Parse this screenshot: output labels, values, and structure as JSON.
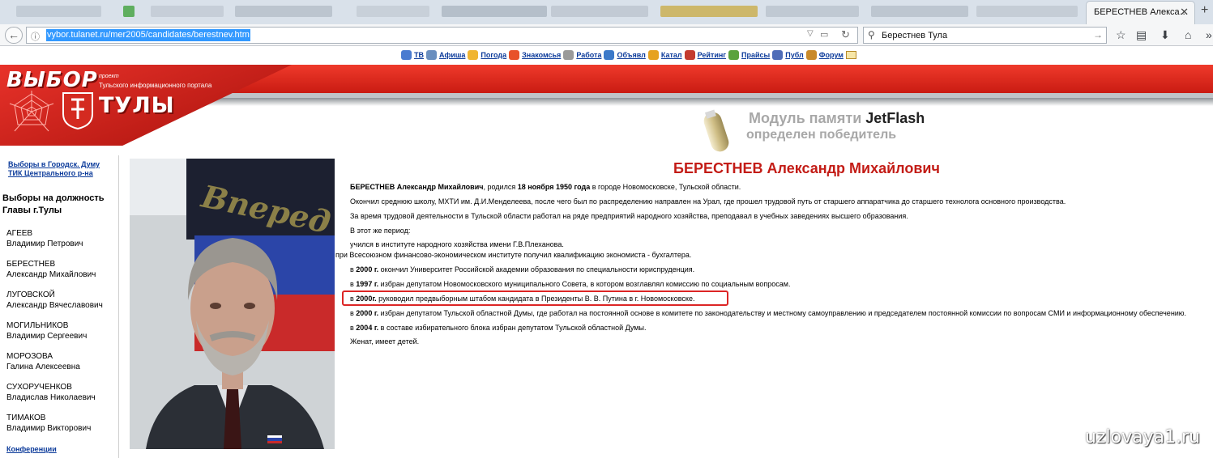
{
  "browser": {
    "tab_title": "БЕРЕСТНЕВ Алекса…",
    "url": "vybor.tulanet.ru/mer2005/candidates/berestnev.htm",
    "search_query": "Берестнев Тула"
  },
  "menu": {
    "items": [
      {
        "label": "ТВ",
        "color": "#4a7bd0"
      },
      {
        "label": "Афиша",
        "color": "#6a8fbf"
      },
      {
        "label": "Погода",
        "color": "#f0b531"
      },
      {
        "label": "Знакомсья",
        "color": "#e8522a"
      },
      {
        "label": "Работа",
        "color": "#9a9a9a"
      },
      {
        "label": "Объявл",
        "color": "#3b79c9"
      },
      {
        "label": "Катал",
        "color": "#e6a21f"
      },
      {
        "label": "Рейтинг",
        "color": "#c43b2e"
      },
      {
        "label": "Прайсы",
        "color": "#5aa23c"
      },
      {
        "label": "Публ",
        "color": "#4f6db8"
      },
      {
        "label": "Форум",
        "color": "#c98a2a"
      }
    ]
  },
  "header": {
    "site_name_1": "ВЫБОР",
    "site_name_2": "ТУЛЫ",
    "project_label": "проект",
    "project_desc": "Тульского информационного портала"
  },
  "ad": {
    "line1_prefix": "Модуль памяти ",
    "line1_brand": "JetFlash",
    "line2": "определен победитель"
  },
  "sidebar": {
    "link1": "Выборы в Городск. Думу",
    "link2": "ТИК Центрального р-на",
    "heading_1": "Выборы на должность",
    "heading_2": "Главы г.Тулы",
    "candidates": [
      {
        "surname": "АГЕЕВ",
        "name": "Владимир Петрович"
      },
      {
        "surname": "БЕРЕСТНЕВ",
        "name": "Александр Михайлович"
      },
      {
        "surname": "ЛУГОВСКОЙ",
        "name": "Александр Вячеславович"
      },
      {
        "surname": "МОГИЛЬНИКОВ",
        "name": "Владимир Сергеевич"
      },
      {
        "surname": "МОРОЗОВА",
        "name": "Галина Алексеевна"
      },
      {
        "surname": "СУХОРУЧЕНКОВ",
        "name": "Владислав Николаевич"
      },
      {
        "surname": "ТИМАКОВ",
        "name": "Владимир Викторович"
      }
    ],
    "conference_link": "Конференции"
  },
  "photo": {
    "flag_text": "Вперед"
  },
  "bio": {
    "title": "БЕРЕСТНЕВ Александр Михайлович",
    "p1_name": "БЕРЕСТНЕВ Александр Михайлович",
    "p1_mid": ", родился ",
    "p1_date": "18 ноября 1950 года",
    "p1_end": " в городе Новомосковске, Тульской области.",
    "p2": "Окончил среднюю школу, МХТИ им. Д.И.Менделеева, после чего был по распределению направлен на Урал, где прошел трудовой путь от старшего аппаратчика до старшего технолога основного производства.",
    "p3": "За время трудовой деятельности в Тульской области работал на ряде предприятий народного хозяйства, преподавал в учебных заведениях высшего образования.",
    "p4": "В этот же период:",
    "p5": "учился в институте народного хозяйства имени Г.В.Плеханова.",
    "p6": "при Всесоюзном финансово-экономическом институте получил квалификацию экономиста - бухгалтера.",
    "items": [
      {
        "pre": "в ",
        "year": "2000 г.",
        "text": " окончил Университет Российской академии образования по специальности юриспруденция."
      },
      {
        "pre": "в ",
        "year": "1997 г.",
        "text": " избран депутатом Новомосковского муниципального Совета, в котором возглавлял комиссию по социальным вопросам."
      },
      {
        "pre": "в ",
        "year": "2000г.",
        "text": " руководил предвыборным штабом кандидата в Президенты В. В. Путина в г. Новомосковске."
      },
      {
        "pre": "в ",
        "year": "2000 г.",
        "text": " избран депутатом Тульской областной Думы, где работал на постоянной основе в комитете по законодательству и местному самоуправлению и председателем постоянной комиссии по вопросам СМИ и информационному обеспечению."
      },
      {
        "pre": "в ",
        "year": "2004 г.",
        "text": " в составе избирательного блока избран депутатом Тульской областной Думы."
      }
    ],
    "p_last": "Женат, имеет детей."
  },
  "watermark": "uzlovaya1.ru"
}
